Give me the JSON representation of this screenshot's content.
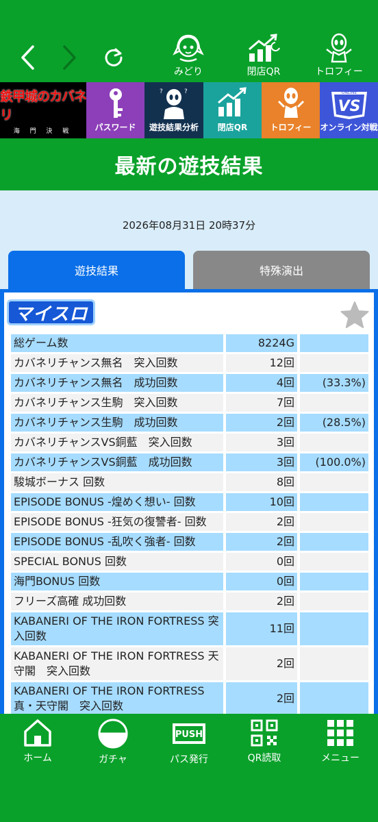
{
  "topbar": {
    "items": [
      {
        "label": "みどり",
        "icon": "character-icon"
      },
      {
        "label": "閉店QR",
        "icon": "chart-up-icon"
      },
      {
        "label": "トロフィー",
        "icon": "trophy-character-icon"
      }
    ]
  },
  "banner": {
    "game_logo": "鉄甲城のカバネリ",
    "game_sub": "海 門 決 戦",
    "tiles": [
      {
        "label": "パスワード",
        "icon": "key-icon",
        "color": "#8c3fb8"
      },
      {
        "label": "遊技結果分析",
        "icon": "analysis-character-icon",
        "color": "#12314f"
      },
      {
        "label": "閉店QR",
        "icon": "chart-up-icon",
        "color": "#1aa39c"
      },
      {
        "label": "トロフィー",
        "icon": "trophy-character-icon",
        "color": "#e9822a"
      },
      {
        "label": "オンライン対戦",
        "icon": "vs-online-icon",
        "color": "#3d55d8"
      }
    ]
  },
  "page_title": "最新の遊技結果",
  "timestamp": "2026年08月31日 20時37分",
  "tabs": [
    {
      "label": "遊技結果",
      "active": true
    },
    {
      "label": "特殊演出",
      "active": false
    }
  ],
  "panel": {
    "logo_text": "マイスロ",
    "rows": [
      {
        "label": "総ゲーム数",
        "value": "8224G",
        "pct": ""
      },
      {
        "label": "カバネリチャンス無名　突入回数",
        "value": "12回",
        "pct": ""
      },
      {
        "label": "カバネリチャンス無名　成功回数",
        "value": "4回",
        "pct": "(33.3%)"
      },
      {
        "label": "カバネリチャンス生駒　突入回数",
        "value": "7回",
        "pct": ""
      },
      {
        "label": "カバネリチャンス生駒　成功回数",
        "value": "2回",
        "pct": "(28.5%)"
      },
      {
        "label": "カバネリチャンスVS銅藍　突入回数",
        "value": "3回",
        "pct": ""
      },
      {
        "label": "カバネリチャンスVS銅藍　成功回数",
        "value": "3回",
        "pct": "(100.0%)"
      },
      {
        "label": "駿城ボーナス 回数",
        "value": "8回",
        "pct": ""
      },
      {
        "label": "EPISODE BONUS -煌めく想い- 回数",
        "value": "10回",
        "pct": ""
      },
      {
        "label": "EPISODE BONUS -狂気の復讐者- 回数",
        "value": "2回",
        "pct": ""
      },
      {
        "label": "EPISODE BONUS -乱吹く強者- 回数",
        "value": "2回",
        "pct": ""
      },
      {
        "label": "SPECIAL BONUS 回数",
        "value": "0回",
        "pct": ""
      },
      {
        "label": "海門BONUS 回数",
        "value": "0回",
        "pct": ""
      },
      {
        "label": "フリーズ高確 成功回数",
        "value": "2回",
        "pct": ""
      },
      {
        "label": "KABANERI OF THE IRON FORTRESS 突入回数",
        "value": "11回",
        "pct": ""
      },
      {
        "label": "KABANERI OF THE IRON FORTRESS 天守閣　突入回数",
        "value": "2回",
        "pct": ""
      },
      {
        "label": "KABANERI OF THE IRON FORTRESS 真・天守閣　突入回数",
        "value": "2回",
        "pct": ""
      }
    ]
  },
  "bottom_nav": [
    {
      "label": "ホーム",
      "icon": "home-icon"
    },
    {
      "label": "ガチャ",
      "icon": "gacha-ball-icon"
    },
    {
      "label": "パス発行",
      "icon": "push-icon",
      "icon_text": "PUSH"
    },
    {
      "label": "QR読取",
      "icon": "qr-code-icon"
    },
    {
      "label": "メニュー",
      "icon": "grid-menu-icon"
    }
  ],
  "colors": {
    "brand_green": "#0aa12a",
    "tab_active": "#0a6fe8",
    "tab_inactive": "#888888",
    "row_blue": "#a6dcff",
    "row_gray": "#f2f2f2",
    "light_bg": "#d9ecf9"
  }
}
